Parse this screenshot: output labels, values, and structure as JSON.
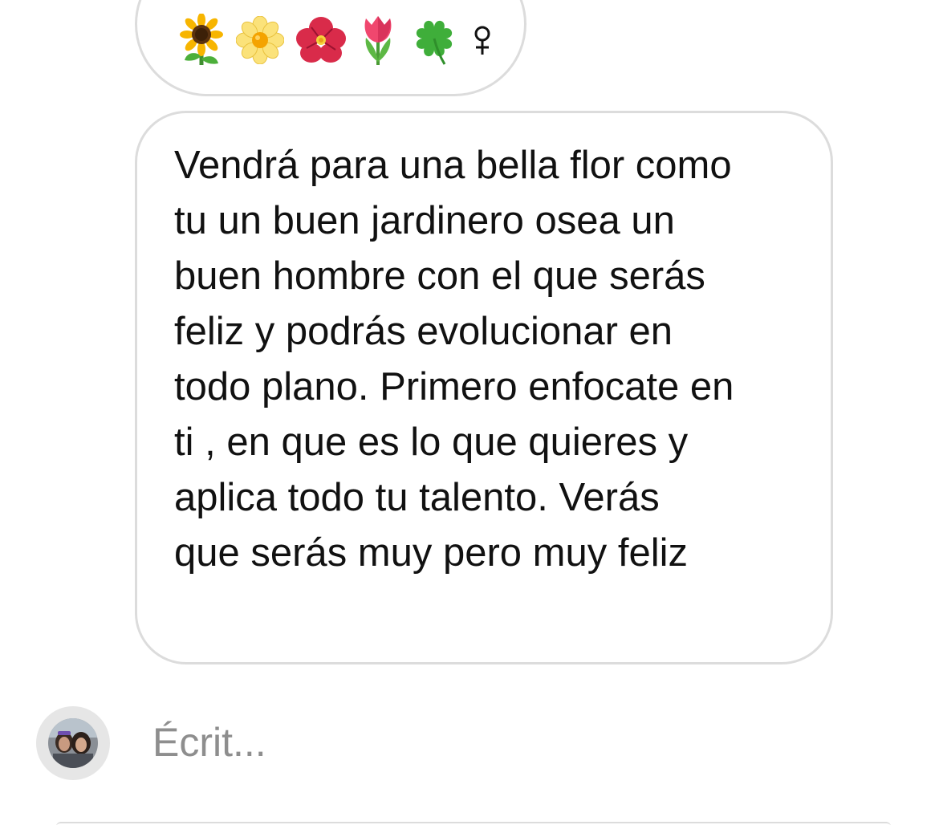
{
  "emoji_message": {
    "icons": [
      "sunflower-icon",
      "blossom-icon",
      "hibiscus-icon",
      "tulip-icon",
      "four-leaf-clover-icon",
      "female-sign-icon"
    ]
  },
  "text_message": {
    "lines": [
      "Vendrá para una bella flor como",
      "tu un buen jardinero osea un",
      "buen hombre con el que serás",
      "feliz y podrás evolucionar en",
      "todo plano. Primero enfocate en",
      "ti , en que es lo que quieres y",
      "aplica todo tu talento. Verás",
      "que serás muy pero muy feliz"
    ]
  },
  "composer": {
    "placeholder": "Écrit..."
  },
  "colors": {
    "bubble_border": "#dcdcdc",
    "text": "#111111",
    "placeholder": "#8e8e8e",
    "avatar_ring": "#e6e6e6"
  }
}
